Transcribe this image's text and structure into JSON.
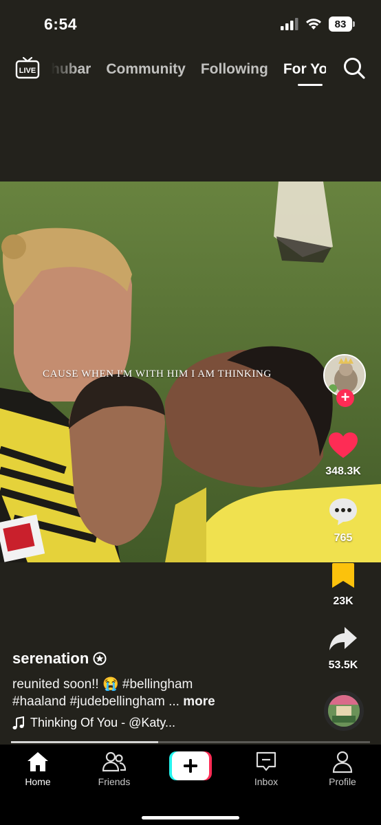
{
  "status_bar": {
    "time": "6:54",
    "battery": "83",
    "icons": [
      "signal-icon",
      "wifi-icon",
      "battery-icon"
    ]
  },
  "top_nav": {
    "live_label": "LIVE",
    "tabs": [
      {
        "label": "hubar",
        "active": false
      },
      {
        "label": "Community",
        "active": false
      },
      {
        "label": "Following",
        "active": false
      },
      {
        "label": "For You",
        "active": true
      }
    ]
  },
  "video": {
    "caption": "CAUSE WHEN I'M WITH HIM I AM THINKING"
  },
  "actions": {
    "likes": "348.3K",
    "comments": "765",
    "saves": "23K",
    "shares": "53.5K"
  },
  "post": {
    "username": "serenation",
    "description_line1": "reunited soon!! 😭 #bellingham",
    "description_line2": "#haaland #judebellingham ...",
    "more_label": "more",
    "sound": "Thinking Of You - @Katy..."
  },
  "playback": {
    "progress": 0.41
  },
  "colors": {
    "accent": "#fe2c55",
    "save": "#fcc20c",
    "background": "#23221c"
  },
  "bottom_nav": {
    "home": "Home",
    "friends": "Friends",
    "inbox": "Inbox",
    "profile": "Profile"
  }
}
